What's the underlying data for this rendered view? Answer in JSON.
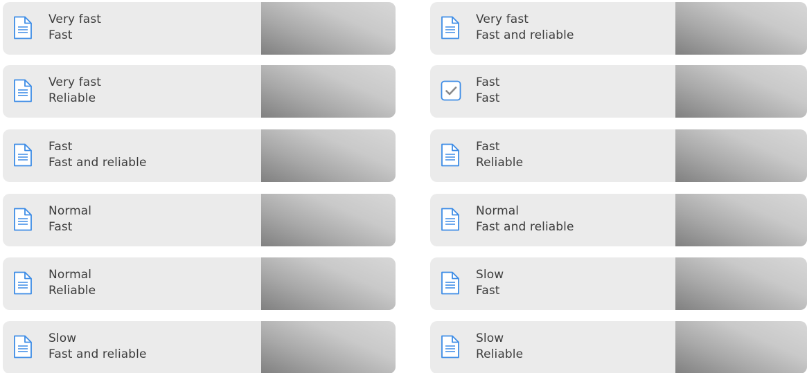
{
  "tiles": [
    {
      "line1": "Very fast",
      "line2": "Fast",
      "icon": "document-icon",
      "selected": false
    },
    {
      "line1": "Very fast",
      "line2": "Fast and reliable",
      "icon": "document-icon",
      "selected": false
    },
    {
      "line1": "Very fast",
      "line2": "Reliable",
      "icon": "document-icon",
      "selected": false
    },
    {
      "line1": "Fast",
      "line2": "Fast",
      "icon": "checkbox-checked-icon",
      "selected": true
    },
    {
      "line1": "Fast",
      "line2": "Fast and reliable",
      "icon": "document-icon",
      "selected": false
    },
    {
      "line1": "Fast",
      "line2": "Reliable",
      "icon": "document-icon",
      "selected": false
    },
    {
      "line1": "Normal",
      "line2": "Fast",
      "icon": "document-icon",
      "selected": false
    },
    {
      "line1": "Normal",
      "line2": "Fast and reliable",
      "icon": "document-icon",
      "selected": false
    },
    {
      "line1": "Normal",
      "line2": "Reliable",
      "icon": "document-icon",
      "selected": false
    },
    {
      "line1": "Slow",
      "line2": "Fast",
      "icon": "document-icon",
      "selected": false
    },
    {
      "line1": "Slow",
      "line2": "Fast and reliable",
      "icon": "document-icon",
      "selected": false
    },
    {
      "line1": "Slow",
      "line2": "Reliable",
      "icon": "document-icon",
      "selected": false
    }
  ],
  "colors": {
    "icon_blue": "#3d8ce6",
    "tile_bg": "#ebebeb",
    "text": "#3c3c3c",
    "check_gray": "#8a8a8a"
  }
}
